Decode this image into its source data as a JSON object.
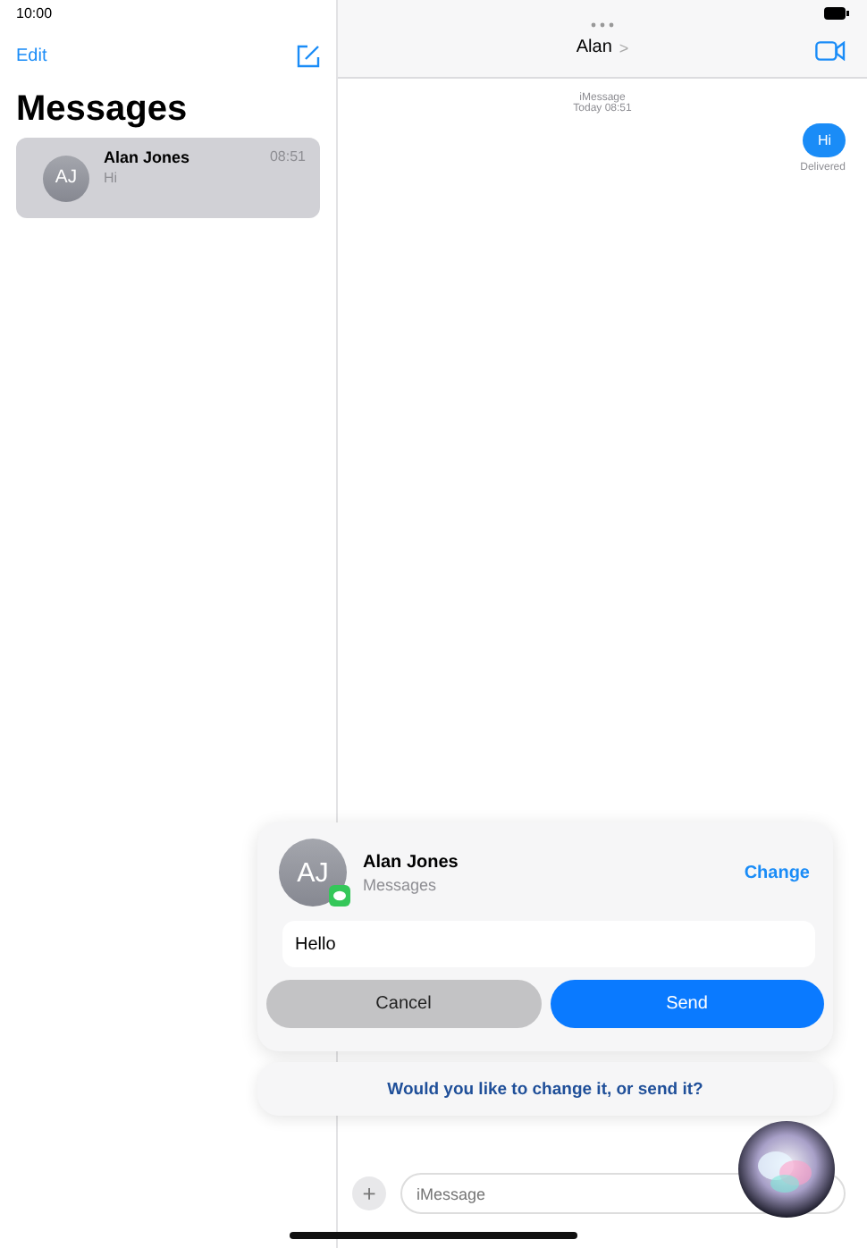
{
  "status_bar": {
    "time": "10:00"
  },
  "sidebar": {
    "edit": "Edit",
    "title": "Messages",
    "conversations": [
      {
        "initials": "AJ",
        "name": "Alan Jones",
        "time": "08:51",
        "preview": "Hi",
        "selected": true
      }
    ]
  },
  "conversation": {
    "contact": "Alan",
    "chevron": ">",
    "service": "iMessage",
    "timestamp": "Today 08:51",
    "messages": [
      {
        "text": "Hi",
        "status": "Delivered"
      }
    ],
    "input_placeholder": "iMessage",
    "add": "+"
  },
  "siri": {
    "initials": "AJ",
    "name": "Alan Jones",
    "app": "Messages",
    "change": "Change",
    "message": "Hello",
    "cancel": "Cancel",
    "send": "Send",
    "prompt": "Would you like to change it, or send it?"
  }
}
